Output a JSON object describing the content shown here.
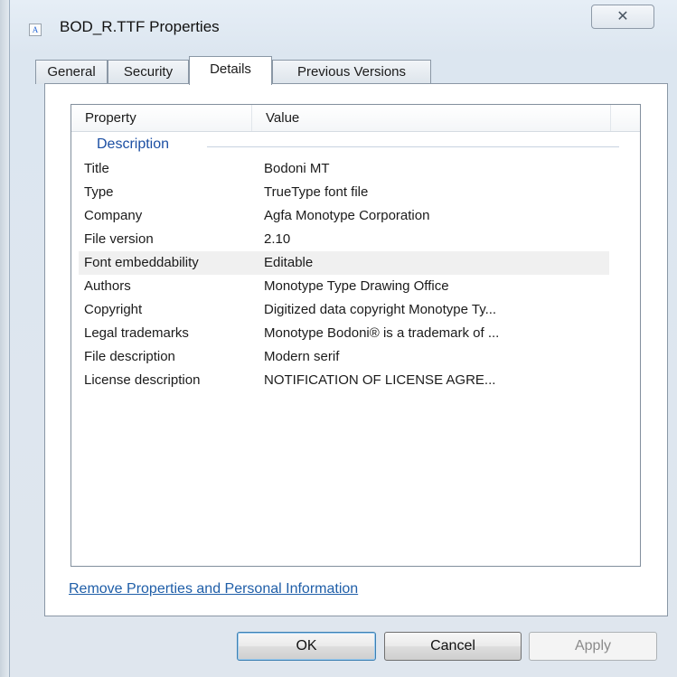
{
  "window": {
    "title": "BOD_R.TTF Properties",
    "icon": "font-file-icon",
    "icon_glyph": "A",
    "close_glyph": "✕"
  },
  "tabs": [
    {
      "label": "General"
    },
    {
      "label": "Security"
    },
    {
      "label": "Details",
      "active": true
    },
    {
      "label": "Previous Versions"
    }
  ],
  "listview": {
    "columns": [
      "Property",
      "Value"
    ],
    "group": "Description",
    "rows": [
      {
        "property": "Title",
        "value": "Bodoni MT"
      },
      {
        "property": "Type",
        "value": "TrueType font file"
      },
      {
        "property": "Company",
        "value": "Agfa Monotype Corporation"
      },
      {
        "property": "File version",
        "value": "2.10"
      },
      {
        "property": "Font embeddability",
        "value": "Editable",
        "selected": true
      },
      {
        "property": "Authors",
        "value": "Monotype Type Drawing Office"
      },
      {
        "property": "Copyright",
        "value": "Digitized data copyright Monotype Ty..."
      },
      {
        "property": "Legal trademarks",
        "value": "Monotype Bodoni® is a trademark of ..."
      },
      {
        "property": "File description",
        "value": "Modern serif"
      },
      {
        "property": "License description",
        "value": "NOTIFICATION OF LICENSE AGRE..."
      }
    ]
  },
  "remove_link": "Remove Properties and Personal Information",
  "buttons": {
    "ok": "OK",
    "cancel": "Cancel",
    "apply": "Apply"
  },
  "colors": {
    "link": "#1f5ea8",
    "group_header": "#1c4fa3",
    "selected_row": "#f0f0f0"
  }
}
